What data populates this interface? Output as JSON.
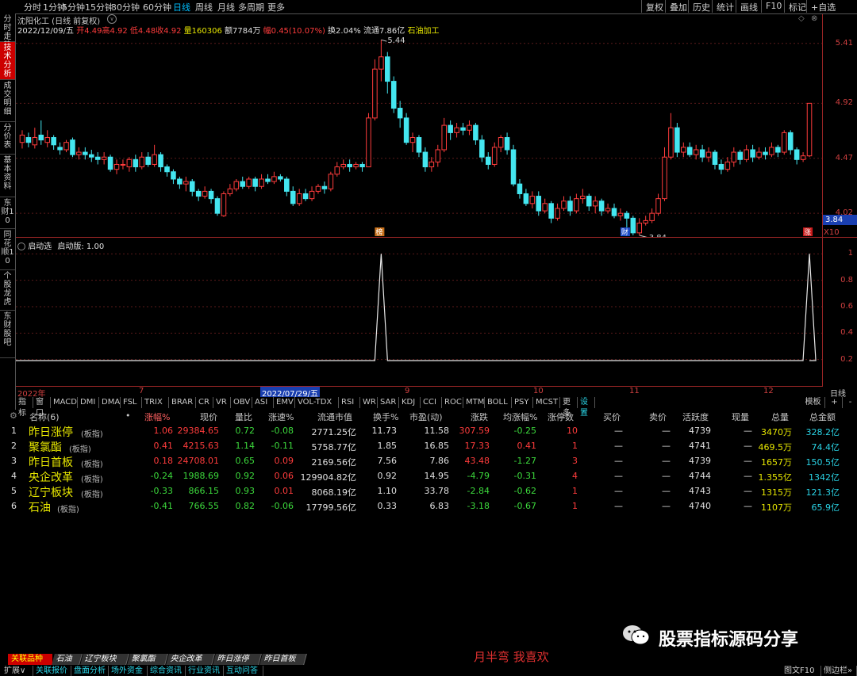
{
  "topbar": {
    "periods": [
      "分时",
      "1分钟",
      "5分钟",
      "15分钟",
      "30分钟",
      "60分钟",
      "日线",
      "周线",
      "月线",
      "多周期",
      "更多"
    ],
    "selected": "日线",
    "right": [
      "复权",
      "叠加",
      "历史",
      "统计",
      "画线",
      "F10",
      "标记",
      "+自选"
    ]
  },
  "lefttabs": [
    "分时走势",
    "技术分析",
    "成交明细",
    "分价表",
    "基本资料",
    "东财10",
    "同花顺10",
    "个股龙虎",
    "东财股吧"
  ],
  "stock": {
    "name_line": "沈阳化工 (日线 前复权)",
    "date": "2022/12/09/五",
    "open": "开4.49",
    "high": "高4.92",
    "low": "低4.48",
    "close": "收4.92",
    "volume": "量160306",
    "amount": "额7784万",
    "pct": "幅0.45(10.07%)",
    "turnover": "换2.04%",
    "float_cap": "流通7.86亿",
    "sector": "石油加工"
  },
  "chart_data": [
    {
      "type": "candlestick",
      "title": "沈阳化工 (日线 前复权)",
      "y_ticks": [
        5.41,
        4.92,
        4.47,
        4.02
      ],
      "y_current_label": "3.84",
      "ylim": [
        3.82,
        5.48
      ],
      "annotations": [
        {
          "text": "5.44",
          "x": "2022/07/29",
          "price": 5.44
        },
        {
          "text": "3.84",
          "x": "2022/10/31",
          "price": 3.84
        }
      ],
      "markers": [
        "榜",
        "财",
        "涨"
      ],
      "x_labels": [
        "2022年",
        "7",
        "2022/07/29/五",
        "9",
        "10",
        "11",
        "12"
      ],
      "candles": [
        [
          4.6,
          4.66,
          4.7,
          4.55
        ],
        [
          4.64,
          4.6,
          4.68,
          4.56
        ],
        [
          4.58,
          4.64,
          4.72,
          4.55
        ],
        [
          4.66,
          4.62,
          4.78,
          4.58
        ],
        [
          4.6,
          4.64,
          4.7,
          4.56
        ],
        [
          4.64,
          4.58,
          4.66,
          4.54
        ],
        [
          4.56,
          4.54,
          4.6,
          4.5
        ],
        [
          4.54,
          4.6,
          4.62,
          4.52
        ],
        [
          4.62,
          4.5,
          4.64,
          4.48
        ],
        [
          4.5,
          4.52,
          4.56,
          4.46
        ],
        [
          4.52,
          4.5,
          4.56,
          4.46
        ],
        [
          4.5,
          4.48,
          4.54,
          4.44
        ],
        [
          4.48,
          4.46,
          4.52,
          4.42
        ],
        [
          4.46,
          4.48,
          4.52,
          4.42
        ],
        [
          4.48,
          4.38,
          4.5,
          4.36
        ],
        [
          4.38,
          4.42,
          4.46,
          4.34
        ],
        [
          4.42,
          4.42,
          4.46,
          4.38
        ],
        [
          4.4,
          4.46,
          4.48,
          4.36
        ],
        [
          4.46,
          4.4,
          4.5,
          4.36
        ],
        [
          4.4,
          4.48,
          4.52,
          4.38
        ],
        [
          4.48,
          4.42,
          4.52,
          4.4
        ],
        [
          4.42,
          4.5,
          4.58,
          4.4
        ],
        [
          4.5,
          4.4,
          4.52,
          4.36
        ],
        [
          4.4,
          4.36,
          4.42,
          4.32
        ],
        [
          4.36,
          4.3,
          4.38,
          4.26
        ],
        [
          4.3,
          4.26,
          4.32,
          4.22
        ],
        [
          4.26,
          4.28,
          4.32,
          4.2
        ],
        [
          4.28,
          4.2,
          4.3,
          4.16
        ],
        [
          4.2,
          4.16,
          4.22,
          4.12
        ],
        [
          4.16,
          4.2,
          4.24,
          4.14
        ],
        [
          4.2,
          4.14,
          4.22,
          4.1
        ],
        [
          4.14,
          4.02,
          4.16,
          4.0
        ],
        [
          4.0,
          4.18,
          4.2,
          3.99
        ],
        [
          4.18,
          4.22,
          4.26,
          4.16
        ],
        [
          4.22,
          4.28,
          4.3,
          4.2
        ],
        [
          4.28,
          4.24,
          4.32,
          4.22
        ],
        [
          4.24,
          4.3,
          4.32,
          4.22
        ],
        [
          4.3,
          4.24,
          4.32,
          4.2
        ],
        [
          4.24,
          4.3,
          4.34,
          4.22
        ],
        [
          4.3,
          4.28,
          4.34,
          4.26
        ],
        [
          4.28,
          4.32,
          4.36,
          4.26
        ],
        [
          4.32,
          4.3,
          4.34,
          4.28
        ],
        [
          4.3,
          4.2,
          4.32,
          4.16
        ],
        [
          4.2,
          4.1,
          4.24,
          4.08
        ],
        [
          4.1,
          4.18,
          4.22,
          4.08
        ],
        [
          4.18,
          4.14,
          4.22,
          4.12
        ],
        [
          4.14,
          4.2,
          4.24,
          4.12
        ],
        [
          4.2,
          4.24,
          4.26,
          4.18
        ],
        [
          4.24,
          4.22,
          4.28,
          4.18
        ],
        [
          4.22,
          4.34,
          4.36,
          4.2
        ],
        [
          4.34,
          4.4,
          4.44,
          4.32
        ],
        [
          4.4,
          4.42,
          4.46,
          4.38
        ],
        [
          4.42,
          4.4,
          4.46,
          4.36
        ],
        [
          4.4,
          4.42,
          4.44,
          4.38
        ],
        [
          4.42,
          4.4,
          4.44,
          4.36
        ],
        [
          4.4,
          4.8,
          4.84,
          4.4
        ],
        [
          4.8,
          5.2,
          5.28,
          4.78
        ],
        [
          5.2,
          5.3,
          5.44,
          5.1
        ],
        [
          5.3,
          5.1,
          5.34,
          5.0
        ],
        [
          5.1,
          4.88,
          5.14,
          4.84
        ],
        [
          4.88,
          4.8,
          4.94,
          4.72
        ],
        [
          4.8,
          4.6,
          4.84,
          4.58
        ],
        [
          4.6,
          4.64,
          4.68,
          4.52
        ],
        [
          4.64,
          4.52,
          4.66,
          4.48
        ],
        [
          4.52,
          4.4,
          4.56,
          4.36
        ],
        [
          4.4,
          4.44,
          4.48,
          4.36
        ],
        [
          4.44,
          4.54,
          4.58,
          4.4
        ],
        [
          4.54,
          4.74,
          4.8,
          4.52
        ],
        [
          4.74,
          4.68,
          4.78,
          4.62
        ],
        [
          4.68,
          4.72,
          4.76,
          4.64
        ],
        [
          4.72,
          4.7,
          4.76,
          4.66
        ],
        [
          4.7,
          4.74,
          4.78,
          4.66
        ],
        [
          4.74,
          4.62,
          4.76,
          4.58
        ],
        [
          4.62,
          4.48,
          4.66,
          4.44
        ],
        [
          4.48,
          4.42,
          4.52,
          4.38
        ],
        [
          4.42,
          4.56,
          4.6,
          4.4
        ],
        [
          4.56,
          4.64,
          4.66,
          4.52
        ],
        [
          4.64,
          4.54,
          4.68,
          4.5
        ],
        [
          4.54,
          4.26,
          4.58,
          4.24
        ],
        [
          4.26,
          4.18,
          4.3,
          4.14
        ],
        [
          4.18,
          4.1,
          4.22,
          4.08
        ],
        [
          4.1,
          4.16,
          4.2,
          4.06
        ],
        [
          4.16,
          4.04,
          4.2,
          4.0
        ],
        [
          4.04,
          4.1,
          4.14,
          4.02
        ],
        [
          4.1,
          3.98,
          4.12,
          3.94
        ],
        [
          3.98,
          4.06,
          4.1,
          3.96
        ],
        [
          4.06,
          4.12,
          4.16,
          4.04
        ],
        [
          4.12,
          4.04,
          4.16,
          4.0
        ],
        [
          4.04,
          4.14,
          4.18,
          4.02
        ],
        [
          4.14,
          4.16,
          4.22,
          4.1
        ],
        [
          4.16,
          4.08,
          4.18,
          4.04
        ],
        [
          4.08,
          4.12,
          4.16,
          4.02
        ],
        [
          4.12,
          4.04,
          4.14,
          4.0
        ],
        [
          4.04,
          4.06,
          4.1,
          4.02
        ],
        [
          4.06,
          4.0,
          4.1,
          3.98
        ],
        [
          4.0,
          4.02,
          4.06,
          3.96
        ],
        [
          4.02,
          3.98,
          4.04,
          3.9
        ],
        [
          3.98,
          3.86,
          4.0,
          3.84
        ],
        [
          3.86,
          3.94,
          3.98,
          3.84
        ],
        [
          3.94,
          3.96,
          4.0,
          3.92
        ],
        [
          3.96,
          4.02,
          4.06,
          3.94
        ],
        [
          4.02,
          4.14,
          4.18,
          4.0
        ],
        [
          4.14,
          4.48,
          4.56,
          4.12
        ],
        [
          4.48,
          4.72,
          4.84,
          4.46
        ],
        [
          4.72,
          4.52,
          4.76,
          4.48
        ],
        [
          4.52,
          4.56,
          4.6,
          4.48
        ],
        [
          4.56,
          4.5,
          4.6,
          4.48
        ],
        [
          4.5,
          4.54,
          4.58,
          4.46
        ],
        [
          4.54,
          4.48,
          4.58,
          4.44
        ],
        [
          4.48,
          4.52,
          4.56,
          4.44
        ],
        [
          4.52,
          4.42,
          4.54,
          4.38
        ],
        [
          4.42,
          4.38,
          4.46,
          4.34
        ],
        [
          4.38,
          4.44,
          4.48,
          4.36
        ],
        [
          4.44,
          4.52,
          4.56,
          4.4
        ],
        [
          4.52,
          4.46,
          4.54,
          4.42
        ],
        [
          4.46,
          4.54,
          4.58,
          4.44
        ],
        [
          4.54,
          4.48,
          4.58,
          4.44
        ],
        [
          4.48,
          4.52,
          4.56,
          4.46
        ],
        [
          4.52,
          4.5,
          4.56,
          4.46
        ],
        [
          4.5,
          4.56,
          4.6,
          4.48
        ],
        [
          4.56,
          4.52,
          4.58,
          4.48
        ],
        [
          4.52,
          4.68,
          4.7,
          4.5
        ],
        [
          4.68,
          4.54,
          4.7,
          4.5
        ],
        [
          4.54,
          4.46,
          4.56,
          4.42
        ],
        [
          4.46,
          4.49,
          4.52,
          4.44
        ],
        [
          4.49,
          4.92,
          4.92,
          4.48
        ]
      ]
    },
    {
      "type": "line",
      "title": "启动选  启动版: 1.00",
      "y_ticks": [
        1.0,
        0.8,
        0.6,
        0.4,
        0.2
      ],
      "ylim": [
        0,
        1.05
      ],
      "series": [
        {
          "name": "启动版",
          "spikes": [
            {
              "index": 57,
              "value": 1.0
            },
            {
              "index": 125,
              "value": 1.0
            }
          ]
        }
      ]
    }
  ],
  "indicator_title": "启动选",
  "indicator_value": "启动版: 1.00",
  "time_axis": [
    "2022年",
    "7",
    "2022/07/29/五",
    "9",
    "10",
    "11",
    "12"
  ],
  "time_axis_right": "日线",
  "indicator_tabs": [
    "指标",
    "窗口",
    "MACD",
    "DMI",
    "DMA",
    "FSL",
    "TRIX",
    "BRAR",
    "CR",
    "VR",
    "OBV",
    "ASI",
    "EMV",
    "VOL-TDX",
    "RSI",
    "WR",
    "SAR",
    "KDJ",
    "CCI",
    "ROC",
    "MTM",
    "BOLL",
    "PSY",
    "MCST",
    "更多",
    "设置"
  ],
  "indicator_right": [
    "模板",
    "+",
    "-"
  ],
  "table": {
    "headers": [
      "名称(6)",
      "•",
      "涨幅%",
      "现价",
      "量比",
      "涨速%",
      "流通市值",
      "换手%",
      "市盈(动)",
      "涨跌",
      "均涨幅%",
      "涨停数",
      "买价",
      "卖价",
      "活跃度",
      "现量",
      "总量",
      "总金额"
    ],
    "rows": [
      {
        "no": "1",
        "name": "昨日涨停",
        "tag": "(板指)",
        "pct": "1.06",
        "price": "29384.65",
        "vr": "0.72",
        "speed": "-0.08",
        "cap": "2771.25亿",
        "turn": "11.73",
        "pe": "11.58",
        "chg": "307.59",
        "avg": "-0.25",
        "limit": "10",
        "buy": "—",
        "sell": "—",
        "act": "4739",
        "cur": "—",
        "vol": "3470万",
        "amt": "328.2亿"
      },
      {
        "no": "2",
        "name": "聚氯酯",
        "tag": "(板指)",
        "pct": "0.41",
        "price": "4215.63",
        "vr": "1.14",
        "speed": "-0.11",
        "cap": "5758.77亿",
        "turn": "1.85",
        "pe": "16.85",
        "chg": "17.33",
        "avg": "0.41",
        "limit": "1",
        "buy": "—",
        "sell": "—",
        "act": "4741",
        "cur": "—",
        "vol": "469.5万",
        "amt": "74.4亿"
      },
      {
        "no": "3",
        "name": "昨日首板",
        "tag": "(板指)",
        "pct": "0.18",
        "price": "24708.01",
        "vr": "0.65",
        "speed": "0.09",
        "cap": "2169.56亿",
        "turn": "7.56",
        "pe": "7.86",
        "chg": "43.48",
        "avg": "-1.27",
        "limit": "3",
        "buy": "—",
        "sell": "—",
        "act": "4739",
        "cur": "—",
        "vol": "1657万",
        "amt": "150.5亿"
      },
      {
        "no": "4",
        "name": "央企改革",
        "tag": "(板指)",
        "pct": "-0.24",
        "price": "1988.69",
        "vr": "0.92",
        "speed": "0.06",
        "cap": "129904.82亿",
        "turn": "0.92",
        "pe": "14.95",
        "chg": "-4.79",
        "avg": "-0.31",
        "limit": "4",
        "buy": "—",
        "sell": "—",
        "act": "4744",
        "cur": "—",
        "vol": "1.355亿",
        "amt": "1342亿"
      },
      {
        "no": "5",
        "name": "辽宁板块",
        "tag": "(板指)",
        "pct": "-0.33",
        "price": "866.15",
        "vr": "0.93",
        "speed": "0.01",
        "cap": "8068.19亿",
        "turn": "1.10",
        "pe": "33.78",
        "chg": "-2.84",
        "avg": "-0.62",
        "limit": "1",
        "buy": "—",
        "sell": "—",
        "act": "4743",
        "cur": "—",
        "vol": "1315万",
        "amt": "121.3亿"
      },
      {
        "no": "6",
        "name": "石油",
        "tag": "(板指)",
        "pct": "-0.41",
        "price": "766.55",
        "vr": "0.82",
        "speed": "-0.06",
        "cap": "17799.56亿",
        "turn": "0.33",
        "pe": "6.83",
        "chg": "-3.18",
        "avg": "-0.67",
        "limit": "1",
        "buy": "—",
        "sell": "—",
        "act": "4740",
        "cur": "—",
        "vol": "1107万",
        "amt": "65.9亿"
      }
    ]
  },
  "watermark": "股票指标源码分享",
  "signature": "月半弯 我喜欢",
  "bottom_tabs": [
    "关联品种",
    "石油",
    "辽宁板块",
    "聚氯酯",
    "央企改革",
    "昨日涨停",
    "昨日首板"
  ],
  "bottom_bar": [
    "扩展∨",
    "关联报价",
    "盘面分析",
    "场外资金",
    "综合资讯",
    "行业资讯",
    "互动问答"
  ],
  "bottom_right": [
    "图文F10",
    "侧边栏»"
  ]
}
